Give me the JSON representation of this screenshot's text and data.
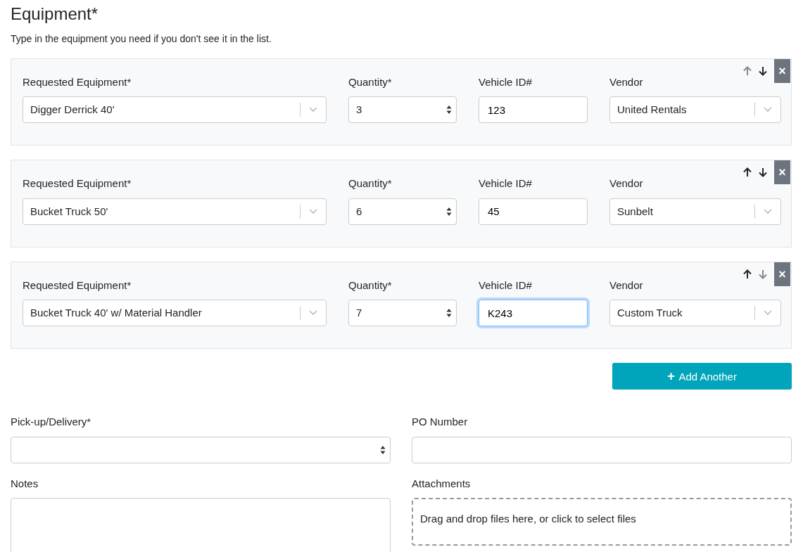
{
  "section": {
    "title": "Equipment*",
    "hint": "Type in the equipment you need if you don't see it in the list."
  },
  "items": [
    {
      "labels": {
        "equipment": "Requested Equipment*",
        "quantity": "Quantity*",
        "vehicle_id": "Vehicle ID#",
        "vendor": "Vendor"
      },
      "equipment": "Digger Derrick 40'",
      "quantity": "3",
      "vehicle_id": "123",
      "vendor": "United Rentals",
      "move_up_disabled": true,
      "move_down_disabled": false,
      "vehicle_id_focused": false,
      "remove": "×"
    },
    {
      "labels": {
        "equipment": "Requested Equipment*",
        "quantity": "Quantity*",
        "vehicle_id": "Vehicle ID#",
        "vendor": "Vendor"
      },
      "equipment": "Bucket Truck 50'",
      "quantity": "6",
      "vehicle_id": "45",
      "vendor": "Sunbelt",
      "move_up_disabled": false,
      "move_down_disabled": false,
      "vehicle_id_focused": false,
      "remove": "×"
    },
    {
      "labels": {
        "equipment": "Requested Equipment*",
        "quantity": "Quantity*",
        "vehicle_id": "Vehicle ID#",
        "vendor": "Vendor"
      },
      "equipment": "Bucket Truck 40' w/ Material Handler",
      "quantity": "7",
      "vehicle_id": "K243",
      "vendor": "Custom Truck",
      "move_up_disabled": false,
      "move_down_disabled": true,
      "vehicle_id_focused": true,
      "remove": "×"
    }
  ],
  "add_button": {
    "icon": "+",
    "label": "Add Another"
  },
  "pickup": {
    "label": "Pick-up/Delivery*"
  },
  "po_number": {
    "label": "PO Number"
  },
  "notes": {
    "label": "Notes"
  },
  "attachments": {
    "label": "Attachments",
    "dropzone": "Drag and drop files here, or click to select files"
  }
}
